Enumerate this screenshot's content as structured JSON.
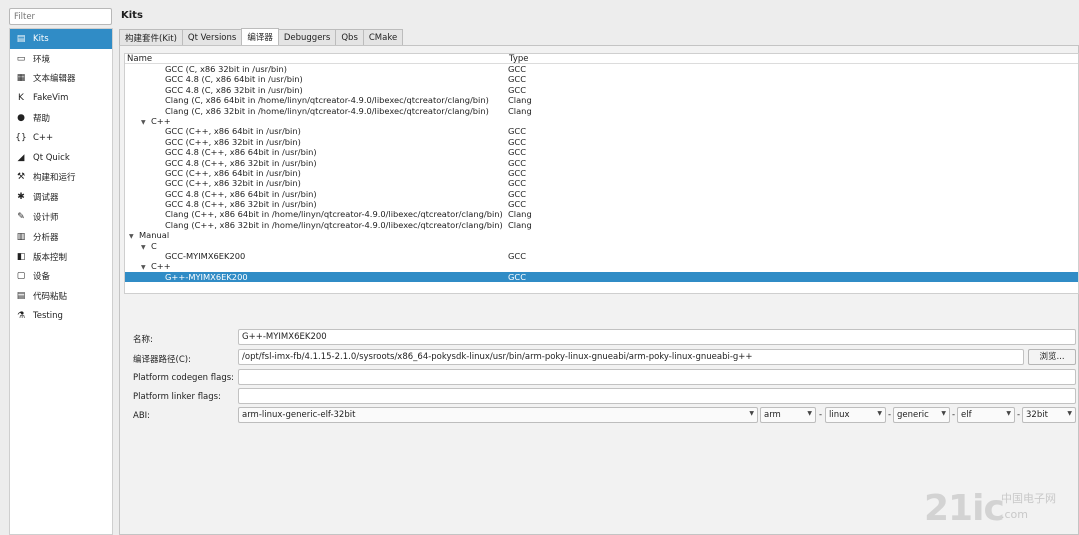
{
  "sidebar": {
    "filter_placeholder": "Filter",
    "items": [
      {
        "icon": "kits-icon",
        "glyph": "▤",
        "label": "Kits"
      },
      {
        "icon": "monitor-icon",
        "glyph": "▭",
        "label": "环境"
      },
      {
        "icon": "document-icon",
        "glyph": "▦",
        "label": "文本编辑器"
      },
      {
        "icon": "fakevim-icon",
        "glyph": "K",
        "label": "FakeVim"
      },
      {
        "icon": "help-icon",
        "glyph": "●",
        "label": "帮助"
      },
      {
        "icon": "braces-icon",
        "glyph": "{}",
        "label": "C++"
      },
      {
        "icon": "qtquick-icon",
        "glyph": "◢",
        "label": "Qt Quick"
      },
      {
        "icon": "hammer-icon",
        "glyph": "⚒",
        "label": "构建和运行"
      },
      {
        "icon": "debugger-icon",
        "glyph": "✱",
        "label": "调试器"
      },
      {
        "icon": "pencil-icon",
        "glyph": "✎",
        "label": "设计师"
      },
      {
        "icon": "analyzer-icon",
        "glyph": "▥",
        "label": "分析器"
      },
      {
        "icon": "version-control-icon",
        "glyph": "◧",
        "label": "版本控制"
      },
      {
        "icon": "device-icon",
        "glyph": "▢",
        "label": "设备"
      },
      {
        "icon": "clipboard-icon",
        "glyph": "▤",
        "label": "代码粘贴"
      },
      {
        "icon": "testing-icon",
        "glyph": "⚗",
        "label": "Testing"
      }
    ]
  },
  "page": {
    "title": "Kits",
    "tabs": [
      "构建套件(Kit)",
      "Qt Versions",
      "编译器",
      "Debuggers",
      "Qbs",
      "CMake"
    ],
    "active_tab": 2
  },
  "tree": {
    "headers": {
      "name": "Name",
      "type": "Type"
    },
    "rows": [
      {
        "indent": 3,
        "arrow": "",
        "name": "GCC (C, x86 32bit in /usr/bin)",
        "type": "GCC"
      },
      {
        "indent": 3,
        "arrow": "",
        "name": "GCC 4.8 (C, x86 64bit in /usr/bin)",
        "type": "GCC"
      },
      {
        "indent": 3,
        "arrow": "",
        "name": "GCC 4.8 (C, x86 32bit in /usr/bin)",
        "type": "GCC"
      },
      {
        "indent": 3,
        "arrow": "",
        "name": "Clang (C, x86 64bit in /home/linyn/qtcreator-4.9.0/libexec/qtcreator/clang/bin)",
        "type": "Clang"
      },
      {
        "indent": 3,
        "arrow": "",
        "name": "Clang (C, x86 32bit in /home/linyn/qtcreator-4.9.0/libexec/qtcreator/clang/bin)",
        "type": "Clang"
      },
      {
        "indent": 1,
        "arrow": "▼",
        "name": "C++",
        "type": ""
      },
      {
        "indent": 3,
        "arrow": "",
        "name": "GCC (C++, x86 64bit in /usr/bin)",
        "type": "GCC"
      },
      {
        "indent": 3,
        "arrow": "",
        "name": "GCC (C++, x86 32bit in /usr/bin)",
        "type": "GCC"
      },
      {
        "indent": 3,
        "arrow": "",
        "name": "GCC 4.8 (C++, x86 64bit in /usr/bin)",
        "type": "GCC"
      },
      {
        "indent": 3,
        "arrow": "",
        "name": "GCC 4.8 (C++, x86 32bit in /usr/bin)",
        "type": "GCC"
      },
      {
        "indent": 3,
        "arrow": "",
        "name": "GCC (C++, x86 64bit in /usr/bin)",
        "type": "GCC"
      },
      {
        "indent": 3,
        "arrow": "",
        "name": "GCC (C++, x86 32bit in /usr/bin)",
        "type": "GCC"
      },
      {
        "indent": 3,
        "arrow": "",
        "name": "GCC 4.8 (C++, x86 64bit in /usr/bin)",
        "type": "GCC"
      },
      {
        "indent": 3,
        "arrow": "",
        "name": "GCC 4.8 (C++, x86 32bit in /usr/bin)",
        "type": "GCC"
      },
      {
        "indent": 3,
        "arrow": "",
        "name": "Clang (C++, x86 64bit in /home/linyn/qtcreator-4.9.0/libexec/qtcreator/clang/bin)",
        "type": "Clang"
      },
      {
        "indent": 3,
        "arrow": "",
        "name": "Clang (C++, x86 32bit in /home/linyn/qtcreator-4.9.0/libexec/qtcreator/clang/bin)",
        "type": "Clang"
      },
      {
        "indent": 0,
        "arrow": "▼",
        "name": "Manual",
        "type": ""
      },
      {
        "indent": 1,
        "arrow": "▼",
        "name": "C",
        "type": ""
      },
      {
        "indent": 3,
        "arrow": "",
        "name": "GCC-MYIMX6EK200",
        "type": "GCC"
      },
      {
        "indent": 1,
        "arrow": "▼",
        "name": "C++",
        "type": ""
      },
      {
        "indent": 3,
        "arrow": "",
        "name": "G++-MYIMX6EK200",
        "type": "GCC",
        "selected": true
      }
    ]
  },
  "form": {
    "name_label": "名称:",
    "name_value": "G++-MYIMX6EK200",
    "path_label": "编译器路径(C):",
    "path_value": "/opt/fsl-imx-fb/4.1.15-2.1.0/sysroots/x86_64-pokysdk-linux/usr/bin/arm-poky-linux-gnueabi/arm-poky-linux-gnueabi-g++",
    "browse_label": "浏览...",
    "codegen_label": "Platform codegen flags:",
    "codegen_value": "",
    "linker_label": "Platform linker flags:",
    "linker_value": "",
    "abi_label": "ABI:",
    "abi_main": "arm-linux-generic-elf-32bit",
    "abi_parts": [
      "arm",
      "linux",
      "generic",
      "elf",
      "32bit"
    ]
  },
  "watermark": {
    "logo": "21ic",
    "cn": "中国电子网",
    "com": ".com"
  },
  "colors": {
    "selection": "#308cc6"
  }
}
